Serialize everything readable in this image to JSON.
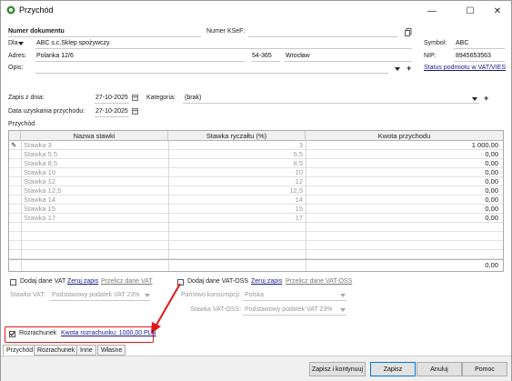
{
  "window": {
    "title": "Przychód",
    "controls": {
      "minimize": "—",
      "maximize": "☐",
      "close": "✕"
    }
  },
  "header": {
    "doc_number_label": "Numer dokumentu",
    "ksef_label": "Numer KSeF:",
    "dla_label": "Dla",
    "dla_value": "ABC s.c.Sklep spożywczy",
    "adres_label": "Adres:",
    "street": "Polanka 12/6",
    "postal_code": "54-365",
    "city": "Wrocław",
    "opis_label": "Opis:",
    "symbol_label": "Symbol:",
    "symbol_value": "ABC",
    "nip_label": "NIP:",
    "nip_value": "8945653563",
    "status_link": "Status podmiotu w VAT/VIES"
  },
  "dates": {
    "zapis_label": "Zapis z dnia:",
    "zapis_value": "27-10-2025",
    "uzyskania_label": "Data uzyskania przychodu:",
    "uzyskania_value": "27-10-2025",
    "kategoria_label": "Kategoria:",
    "kategoria_value": "(brak)"
  },
  "table": {
    "section_label": "Przychód",
    "columns": [
      "Nazwa stawki",
      "Stawka ryczałtu (%)",
      "Kwota przychodu"
    ],
    "rows": [
      {
        "name": "Stawka 3",
        "rate": "3",
        "amount": "1 000,00"
      },
      {
        "name": "Stawka 5,5",
        "rate": "5,5",
        "amount": "0,00"
      },
      {
        "name": "Stawka 8,5",
        "rate": "8,5",
        "amount": "0,00"
      },
      {
        "name": "Stawka 10",
        "rate": "10",
        "amount": "0,00"
      },
      {
        "name": "Stawka 12",
        "rate": "12",
        "amount": "0,00"
      },
      {
        "name": "Stawka 12,5",
        "rate": "12,5",
        "amount": "0,00"
      },
      {
        "name": "Stawka 14",
        "rate": "14",
        "amount": "0,00"
      },
      {
        "name": "Stawka 15",
        "rate": "15",
        "amount": "0,00"
      },
      {
        "name": "Stawka 17",
        "rate": "17",
        "amount": "0,00"
      }
    ],
    "total": "0,00"
  },
  "vat": {
    "add_vat_label": "Dodaj dane VAT",
    "zeruj_label": "Zeruj zapis",
    "przelicz_label": "Przelicz dane VAT",
    "stawka_vat_label": "Stawka VAT:",
    "stawka_vat_value": "Podstawowy podatek VAT 23%"
  },
  "vat_oss": {
    "add_label": "Dodaj dane VAT-OSS",
    "zeruj_label": "Zeruj zapis",
    "przelicz_label": "Przelicz dane VAT-OSS",
    "panstwo_label": "Państwo konsumpcji:",
    "panstwo_value": "Polska",
    "stawka_label": "Stawka VAT-OSS:",
    "stawka_value": "Podstawowy podatek VAT 23%"
  },
  "rozrachunek": {
    "label": "Rozrachunek",
    "checked": true,
    "amount_link": "Kwota rozrachunku: 1000,00 PLN"
  },
  "tabs": [
    "Przychód",
    "Rozrachunek",
    "Inne",
    "Własne"
  ],
  "buttons": {
    "save_continue": "Zapisz i kontynuuj",
    "save": "Zapisz",
    "cancel": "Anuluj",
    "help": "Pomoc"
  },
  "colors": {
    "link": "#1a1a8a",
    "highlight": "#e21818",
    "arrow": "#e21818"
  }
}
